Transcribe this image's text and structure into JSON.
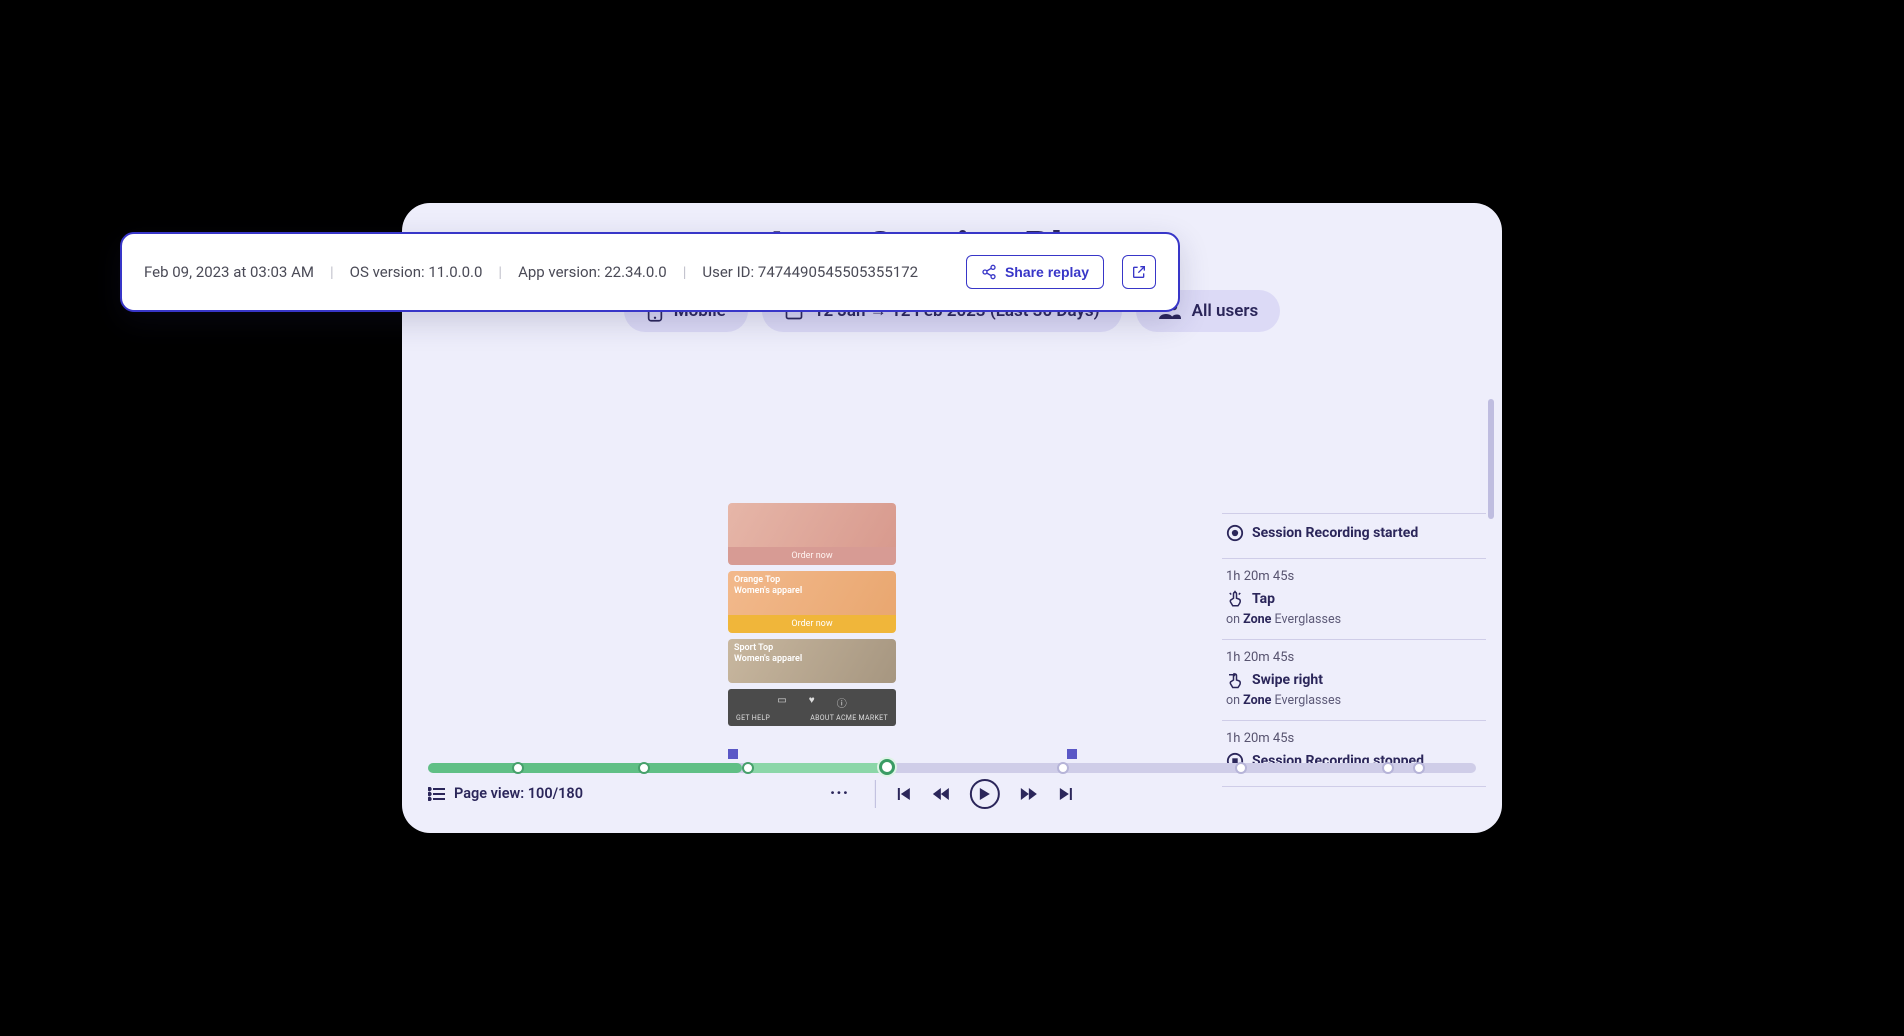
{
  "title": "Apps Session Player",
  "filters": {
    "device": "Mobile",
    "daterange": "12 Jan → 12 Feb 2023 (Last 30 Days)",
    "users": "All users"
  },
  "session_info": {
    "timestamp": "Feb 09, 2023 at 03:03 AM",
    "os_label": "OS version:",
    "os_value": "11.0.0.0",
    "app_label": "App version:",
    "app_value": "22.34.0.0",
    "userid_label": "User ID:",
    "userid_value": "7474490545505355172",
    "share_label": "Share replay"
  },
  "preview": {
    "cards": [
      {
        "title": "",
        "subtitle": "",
        "cta": "Order now"
      },
      {
        "title": "Orange Top",
        "subtitle": "Women's apparel",
        "cta": "Order now"
      },
      {
        "title": "Sport Top",
        "subtitle": "Women's apparel",
        "cta": ""
      }
    ],
    "footer_left": "GET HELP",
    "footer_right": "ABOUT ACME  MARKET"
  },
  "events": [
    {
      "ts": "",
      "icon": "record",
      "title": "Session Recording started",
      "sub_prefix": "",
      "sub_zone": "",
      "sub_target": ""
    },
    {
      "ts": "1h 20m 45s",
      "icon": "tap",
      "title": "Tap",
      "sub_prefix": "on ",
      "sub_zone": "Zone",
      "sub_target": " Everglasses"
    },
    {
      "ts": "1h 20m 45s",
      "icon": "swipe",
      "title": "Swipe right",
      "sub_prefix": "on ",
      "sub_zone": "Zone",
      "sub_target": " Everglasses"
    },
    {
      "ts": "1h 20m 45s",
      "icon": "stop",
      "title": "Session Recording stopped",
      "sub_prefix": "",
      "sub_zone": "",
      "sub_target": ""
    }
  ],
  "page_view": {
    "label": "Page view: ",
    "value": "100/180"
  },
  "controls": {
    "more": "···"
  }
}
